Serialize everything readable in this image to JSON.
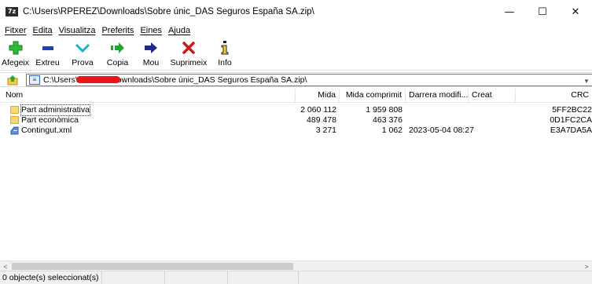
{
  "window": {
    "app_icon_text": "7z",
    "title": "C:\\Users\\RPEREZ\\Downloads\\Sobre únic_DAS Seguros España SA.zip\\",
    "controls": [
      "—",
      "☐",
      "✕"
    ]
  },
  "menu": [
    "Fitxer",
    "Edita",
    "Visualitza",
    "Preferits",
    "Eines",
    "Ajuda"
  ],
  "toolbar": {
    "buttons": [
      {
        "label": "Afegeix",
        "icon": "plus-icon",
        "color": "#1fa82e"
      },
      {
        "label": "Extreu",
        "icon": "minus-icon",
        "color": "#1d3fb8"
      },
      {
        "label": "Prova",
        "icon": "check-chevron-icon",
        "color": "#1bb3c8"
      },
      {
        "label": "Copia",
        "icon": "double-arrow-right-icon",
        "color": "#1fa82e"
      },
      {
        "label": "Mou",
        "icon": "arrow-right-icon",
        "color": "#1d2b8f"
      },
      {
        "label": "Suprimeix",
        "icon": "delete-x-icon",
        "color": "#d01818"
      },
      {
        "label": "Info",
        "icon": "info-icon",
        "color": "#1a1a1a"
      }
    ]
  },
  "address": {
    "prefix": "C:\\Users\\",
    "suffix": "ownloads\\Sobre únic_DAS Seguros España SA.zip\\",
    "redaction_color": "#e8161c"
  },
  "columns": [
    "Nom",
    "Mida",
    "Mida comprimit",
    "Darrera modifi...",
    "Creat",
    "CRC"
  ],
  "files": [
    {
      "name": "Part administrativa",
      "type": "folder",
      "size": "2 060 112",
      "packed": "1 959 808",
      "modified": "",
      "created": "",
      "crc": "5FF2BC22"
    },
    {
      "name": "Part econòmica",
      "type": "folder",
      "size": "489 478",
      "packed": "463 376",
      "modified": "",
      "created": "",
      "crc": "0D1FC2CA"
    },
    {
      "name": "Contingut.xml",
      "type": "file",
      "size": "3 271",
      "packed": "1 062",
      "modified": "2023-05-04 08:27",
      "created": "",
      "crc": "E3A7DA5A"
    }
  ],
  "status": {
    "selected": "0 objecte(s) seleccionat(s)"
  }
}
